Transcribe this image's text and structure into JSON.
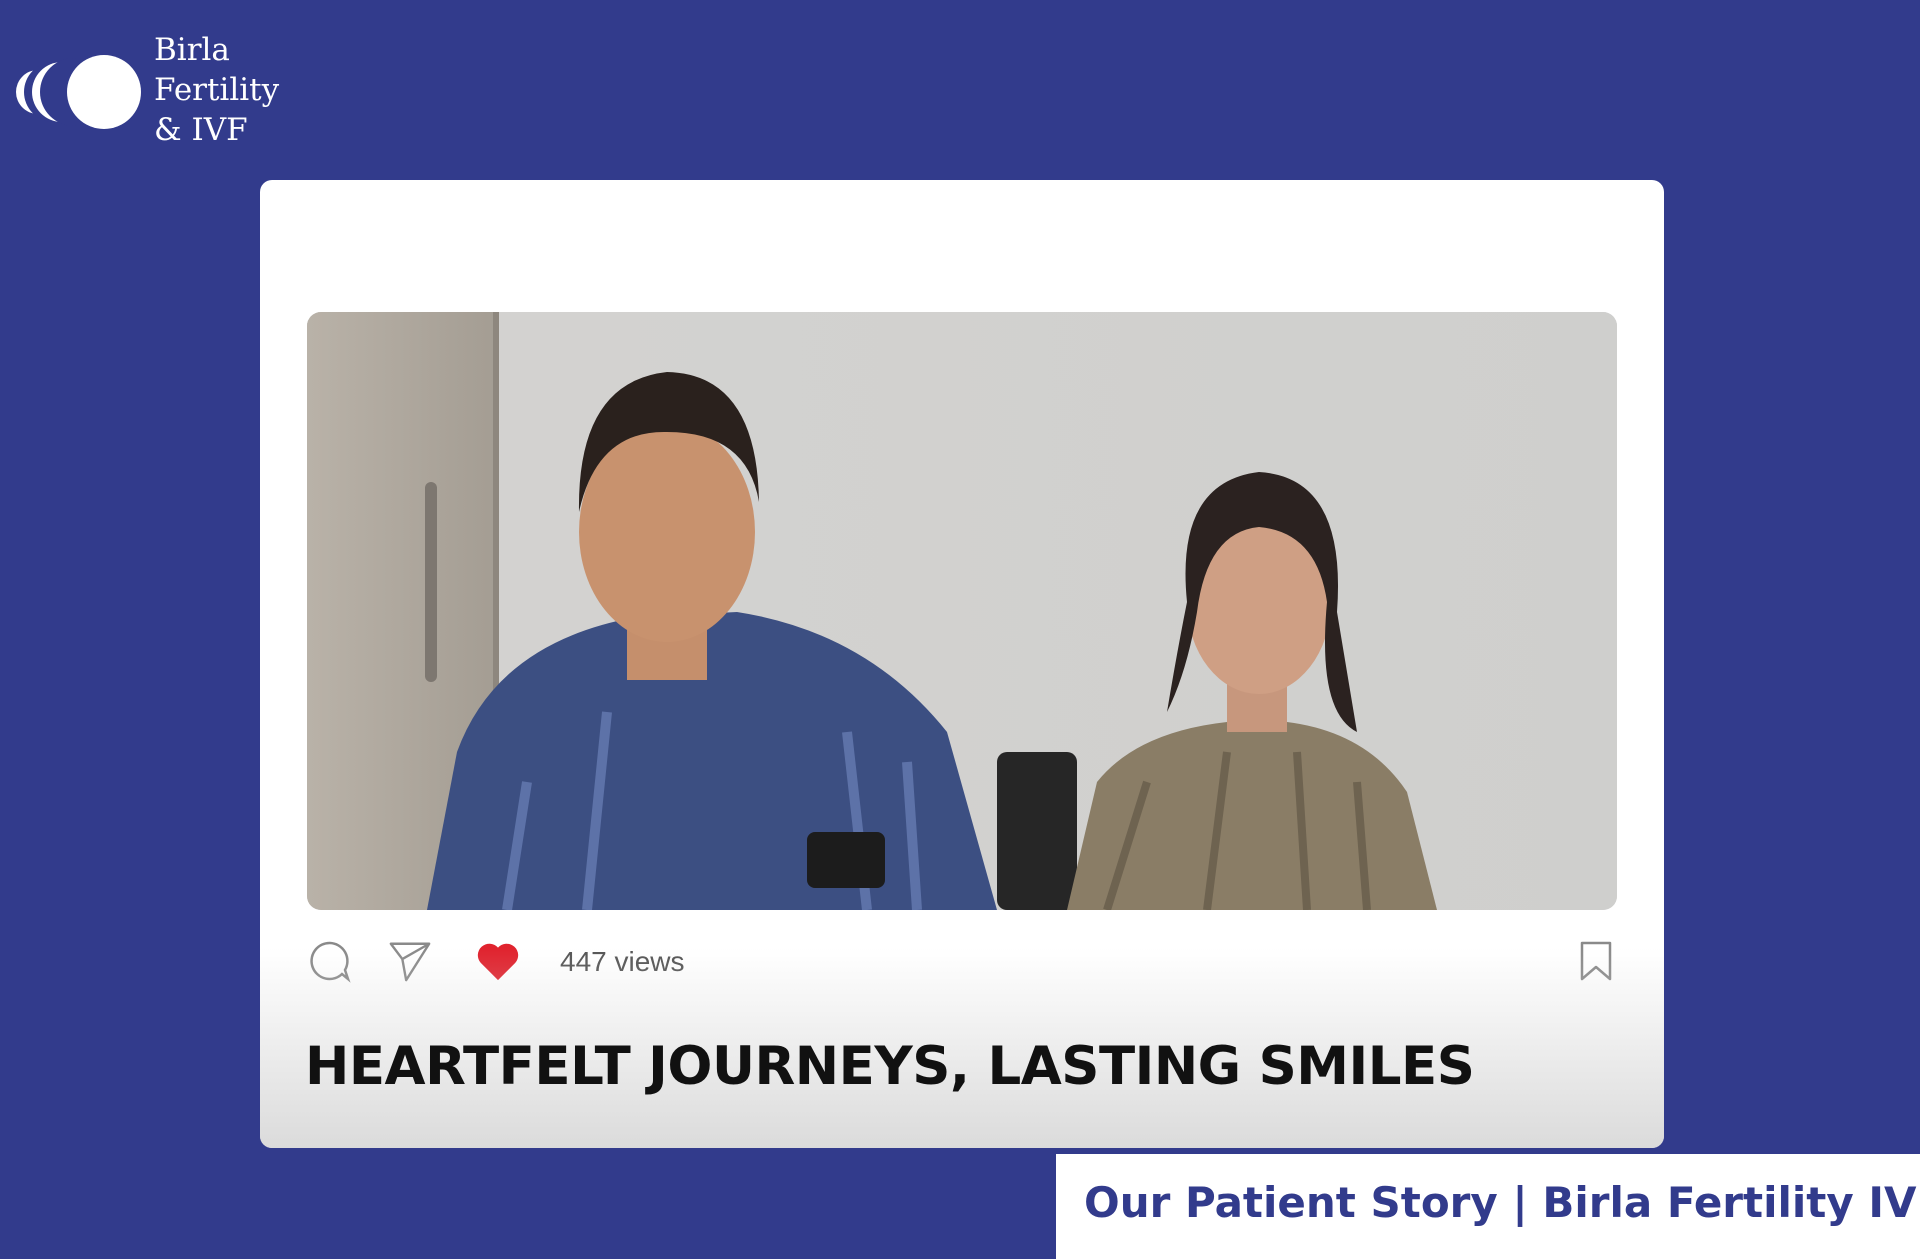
{
  "brand": {
    "logo_icon": "birla-fertility-logo-icon",
    "name_lines": [
      "Birla",
      "Fertility",
      "& IVF"
    ]
  },
  "post": {
    "actions": {
      "comment_icon": "comment-icon",
      "share_icon": "send-icon",
      "like_icon": "heart-icon",
      "save_icon": "bookmark-icon"
    },
    "views_label": "447 views",
    "headline": "HEARTFELT JOURNEYS, LASTING SMILES"
  },
  "footer": {
    "caption": "Our Patient Story | Birla Fertility IVF"
  },
  "colors": {
    "background": "#323b8c",
    "card": "#ffffff",
    "heart": "#e0232e",
    "footer_text": "#323b8c"
  }
}
